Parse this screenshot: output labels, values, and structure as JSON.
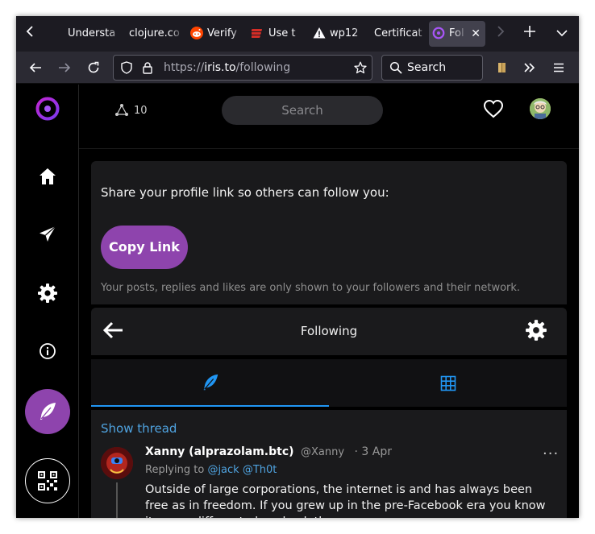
{
  "browser": {
    "tabs": [
      {
        "label": "Understa",
        "icon": "none"
      },
      {
        "label": "clojure.co",
        "icon": "none"
      },
      {
        "label": "Verify",
        "icon": "reddit-icon"
      },
      {
        "label": "Use t",
        "icon": "lastpass-icon"
      },
      {
        "label": "wp12",
        "icon": "warning-icon"
      },
      {
        "label": "Certificat",
        "icon": "none"
      },
      {
        "label": "Fol",
        "icon": "iris-icon",
        "active": true
      }
    ],
    "url_protocol": "https://",
    "url_host": "iris.to",
    "url_path": "/following",
    "search_label": "Search"
  },
  "header": {
    "peer_count": "10",
    "search_placeholder": "Search"
  },
  "share": {
    "text": "Share your profile link so others can follow you:",
    "button": "Copy Link",
    "note": "Your posts, replies and likes are only shown to your followers and their network."
  },
  "following": {
    "title": "Following"
  },
  "post": {
    "show_thread": "Show thread",
    "author_name": "Xanny (alprazolam.btc)",
    "author_handle": "@Xanny",
    "time": "· 3 Apr",
    "more": "···",
    "replying_prefix": "Replying to",
    "mention_1": "@jack",
    "mention_2": "@Th0t",
    "text": "Outside of large corporations, the internet is and has always been free as in freedom. If you grew up in the pre-Facebook era you know it was a different place back then."
  },
  "colors": {
    "accent_purple": "#8e44ad",
    "link_blue": "#4fa3e0",
    "tab_indicator": "#2196f3"
  }
}
